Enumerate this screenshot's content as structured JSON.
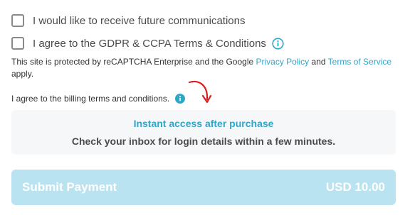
{
  "consent": {
    "communications_label": "I would like to receive future communications",
    "gdpr_label": "I agree to the GDPR & CCPA Terms & Conditions"
  },
  "recaptcha": {
    "text_before": "This site is protected by reCAPTCHA Enterprise and the Google ",
    "privacy_link": "Privacy Policy",
    "text_and": " and ",
    "terms_link": "Terms of Service",
    "text_after": " apply."
  },
  "billing": {
    "label": "I agree to the billing terms and conditions."
  },
  "info_box": {
    "title": "Instant access after purchase",
    "text": "Check your inbox for login details within a few minutes."
  },
  "submit": {
    "label": "Submit Payment",
    "amount": "USD 10.00"
  },
  "colors": {
    "accent": "#2fa7c9",
    "button_bg": "#b9e3f0",
    "arrow": "#d62020"
  },
  "icons": {
    "info": "info-icon",
    "arrow": "red-curved-arrow-icon"
  }
}
